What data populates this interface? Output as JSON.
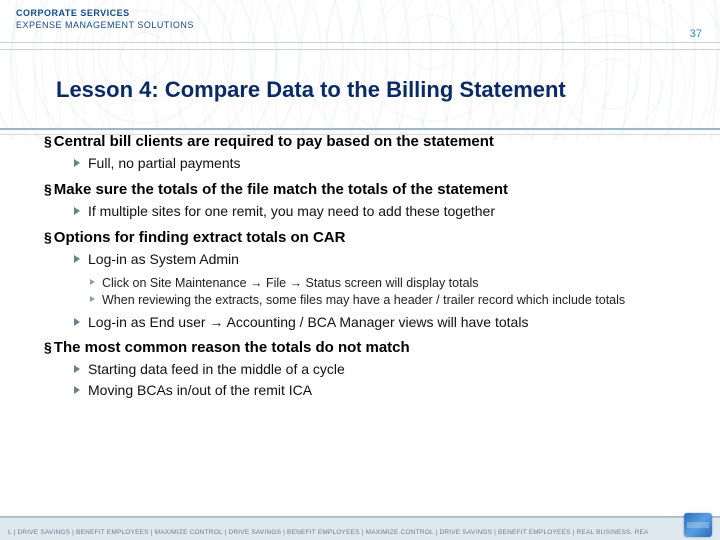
{
  "header": {
    "brand_line1": "CORPORATE SERVICES",
    "brand_line2": "EXPENSE MANAGEMENT SOLUTIONS",
    "page_number": "37"
  },
  "title": "Lesson 4: Compare Data to the Billing Statement",
  "sections": [
    {
      "head": "Central bill clients are required to pay based on the statement",
      "bullets": [
        {
          "text": "Full, no partial payments"
        }
      ]
    },
    {
      "head": "Make sure the totals of the file match the totals of the statement",
      "bullets": [
        {
          "text": "If multiple sites for one remit, you may need to add these together"
        }
      ]
    },
    {
      "head": "Options for finding extract totals on CAR",
      "bullets": [
        {
          "text": "Log-in as System Admin",
          "sub": [
            "Click on Site Maintenance → File → Status screen will display totals",
            "When reviewing the extracts, some files may have a header / trailer record which include totals"
          ]
        },
        {
          "text": "Log-in as End user → Accounting / BCA Manager views will have totals"
        }
      ]
    },
    {
      "head": "The most common reason the totals do not match",
      "bullets": [
        {
          "text": "Starting data feed in the middle of a cycle"
        },
        {
          "text": "Moving BCAs in/out of the remit ICA"
        }
      ]
    }
  ],
  "footer": {
    "tagline": "L | DRIVE SAVINGS | BENEFIT EMPLOYEES | MAXIMIZE CONTROL | DRIVE SAVINGS | BENEFIT EMPLOYEES | MAXIMIZE CONTROL | DRIVE SAVINGS | BENEFIT EMPLOYEES | REAL BUSINESS. REAL SOLUTIONS."
  }
}
